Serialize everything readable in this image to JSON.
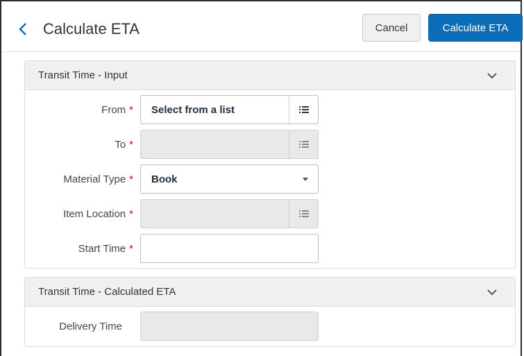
{
  "header": {
    "title": "Calculate ETA",
    "cancel_label": "Cancel",
    "calculate_label": "Calculate ETA"
  },
  "sections": {
    "input": {
      "title": "Transit Time - Input",
      "fields": {
        "from": {
          "label": "From",
          "value": "Select from a list",
          "required": "*"
        },
        "to": {
          "label": "To",
          "value": "",
          "required": "*"
        },
        "material_type": {
          "label": "Material Type",
          "value": "Book",
          "required": "*"
        },
        "item_location": {
          "label": "Item Location",
          "value": "",
          "required": "*"
        },
        "start_time": {
          "label": "Start Time",
          "value": "",
          "required": "*"
        }
      }
    },
    "calculated": {
      "title": "Transit Time - Calculated ETA",
      "fields": {
        "delivery_time": {
          "label": "Delivery Time",
          "value": ""
        }
      }
    }
  },
  "icons": {
    "back": "chevron-left-icon",
    "collapse": "chevron-down-icon",
    "list": "list-icon",
    "dropdown": "caret-down-icon"
  },
  "colors": {
    "primary": "#0b6cb8",
    "required": "#d0021b",
    "section_header_bg": "#f0f0f0",
    "disabled_bg": "#e9e9e9"
  }
}
